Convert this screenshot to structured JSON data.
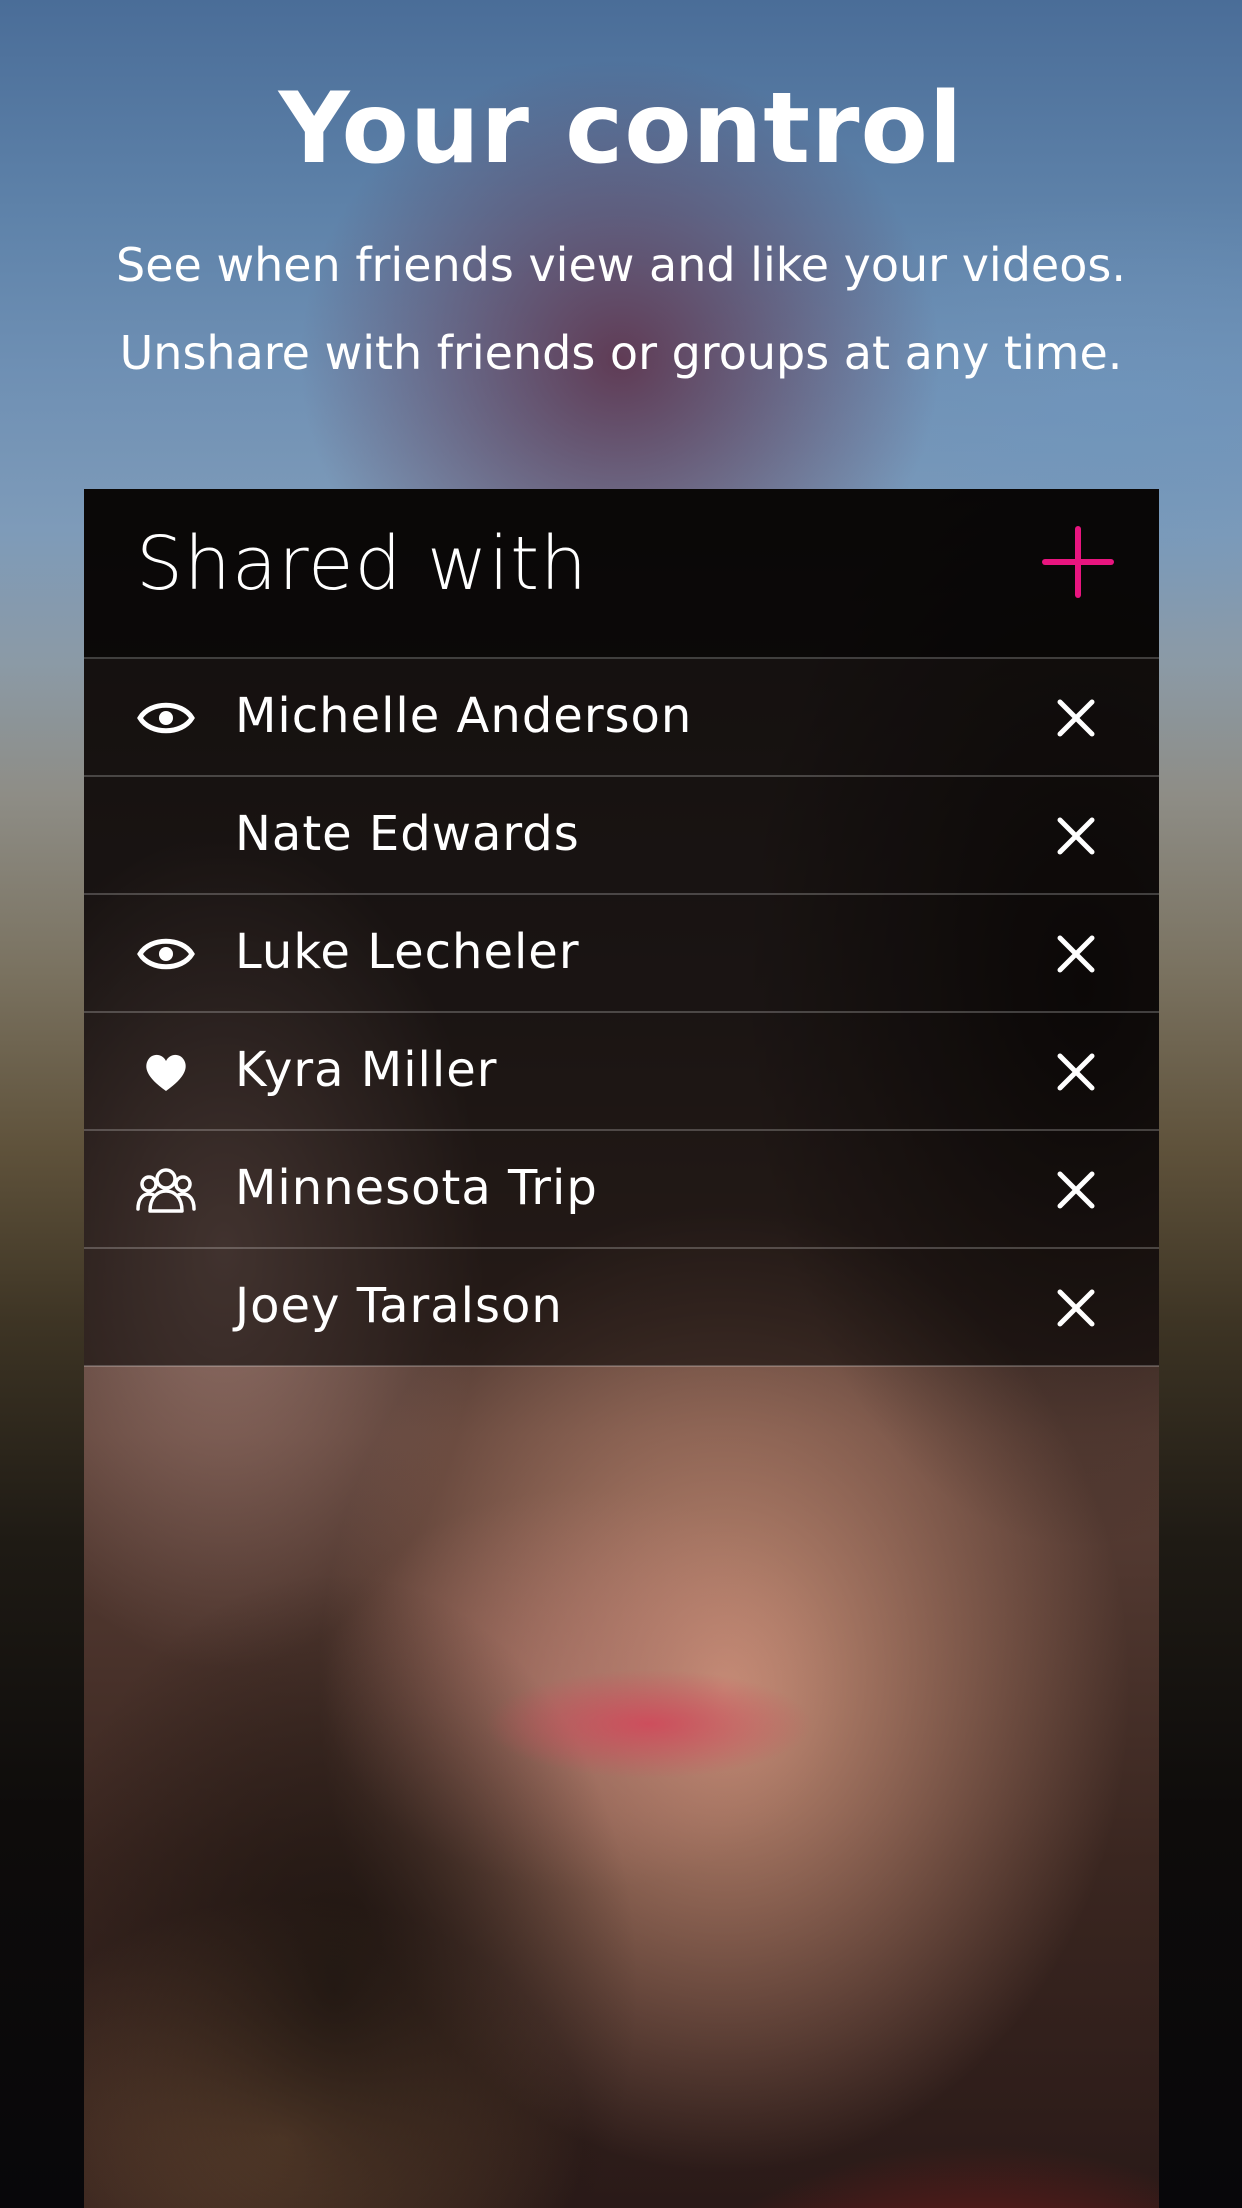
{
  "hero": {
    "title": "Your control",
    "line1": "See when friends view and like your videos.",
    "line2": "Unshare with friends or groups at any time."
  },
  "card": {
    "title": "Shared with",
    "add_icon": "plus-icon",
    "accent_color": "#e8157f"
  },
  "shared_list": [
    {
      "name": "Michelle Anderson",
      "status_icon": "eye-icon",
      "remove_icon": "close-icon"
    },
    {
      "name": "Nate Edwards",
      "status_icon": "",
      "remove_icon": "close-icon"
    },
    {
      "name": "Luke Lecheler",
      "status_icon": "eye-icon",
      "remove_icon": "close-icon"
    },
    {
      "name": "Kyra Miller",
      "status_icon": "heart-icon",
      "remove_icon": "close-icon"
    },
    {
      "name": "Minnesota Trip",
      "status_icon": "group-icon",
      "remove_icon": "close-icon"
    },
    {
      "name": "Joey Taralson",
      "status_icon": "",
      "remove_icon": "close-icon"
    }
  ]
}
